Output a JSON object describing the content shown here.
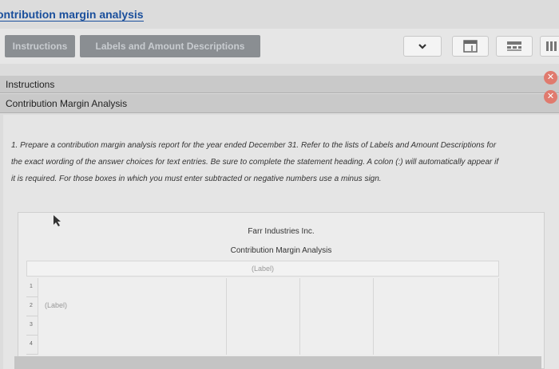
{
  "page_title": "ontribution margin analysis",
  "tabs": [
    {
      "label": "Instructions"
    },
    {
      "label": "Labels and Amount Descriptions"
    }
  ],
  "toolbar": {
    "icons": [
      "chevron-down-icon",
      "form-icon",
      "grid-icon",
      "list-icon"
    ]
  },
  "panels": [
    {
      "title": "Instructions"
    },
    {
      "title": "Contribution Margin Analysis"
    }
  ],
  "instructions": {
    "line1": "1. Prepare a contribution margin analysis report for the year ended December 31. Refer to the lists of Labels and Amount Descriptions for",
    "line2": "the exact wording of the answer choices for text entries. Be sure to complete the statement heading. A colon (:) will automatically appear if",
    "line3": "it is required. For those boxes in which you must enter subtracted or negative numbers use a minus sign."
  },
  "report": {
    "company": "Farr Industries Inc.",
    "statement": "Contribution Margin Analysis",
    "heading_placeholder": "(Label)",
    "rows": [
      {
        "num": "1",
        "label": ""
      },
      {
        "num": "2",
        "label": "(Label)"
      },
      {
        "num": "3",
        "label": ""
      },
      {
        "num": "4",
        "label": ""
      }
    ]
  },
  "colors": {
    "title_link": "#1a4f9c",
    "tab_bg": "#8a8e92",
    "close_button": "#e07a6e"
  }
}
